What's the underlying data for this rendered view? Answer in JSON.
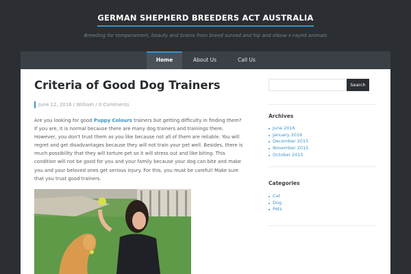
{
  "header": {
    "site_title": "GERMAN SHEPHERD BREEDERS ACT AUSTRALIA",
    "tagline": "Breeding for temperament, beauty and brains from breed surved and hip and elbow x-rayed animals"
  },
  "nav": {
    "items": [
      {
        "label": "Home",
        "active": true
      },
      {
        "label": "About Us",
        "active": false
      },
      {
        "label": "Call Us",
        "active": false
      }
    ]
  },
  "post": {
    "title": "Criteria of Good Dog Trainers",
    "meta": {
      "date": "June 12, 2016",
      "author": "William",
      "comments": "0 Comments",
      "sep": "/"
    },
    "body": {
      "intro": "Are you looking for good ",
      "link": "Puppy Colours",
      "rest": " trainers but getting difficulty in finding them? If you are, it is normal because there are many dog trainers and trainings there. However, you don't trust them as you like because not all of them are reliable. You will regret and get disadvantages because they will not train your pet well. Besides, there is much possibility that they will torture pet so it will stress out and like biting. This condition will not be good for you and your family because your dog can bite and make you and your beloved ones get serious injury. For this, you must be careful! Make sure that you trust good trainers."
    }
  },
  "sidebar": {
    "search": {
      "placeholder": "",
      "button_label": "Search"
    },
    "archives": {
      "title": "Archives",
      "items": [
        "June 2016",
        "January 2016",
        "December 2015",
        "November 2015",
        "October 2015"
      ]
    },
    "categories": {
      "title": "Categories",
      "items": [
        "Cat",
        "Dog",
        "Pets"
      ]
    }
  },
  "colors": {
    "accent": "#3a94c6",
    "background": "#2b2f33",
    "nav": "#3a4046"
  }
}
